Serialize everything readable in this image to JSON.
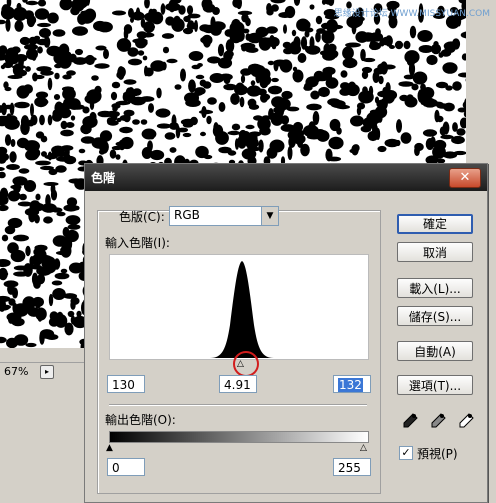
{
  "watermark": "思缘设计论坛 WWW.MISSYUAN.COM",
  "status": {
    "zoom": "67%"
  },
  "dialog": {
    "title": "色階",
    "close_label": "✕",
    "channel_label": "色版(C):",
    "channel_value": "RGB",
    "input_levels_label": "輸入色階(I):",
    "input_black": "130",
    "input_gamma": "4.91",
    "input_white": "132",
    "output_levels_label": "輸出色階(O):",
    "output_black": "0",
    "output_white": "255",
    "buttons": {
      "ok": "確定",
      "cancel": "取消",
      "load": "載入(L)...",
      "save": "儲存(S)...",
      "auto": "自動(A)",
      "options": "選項(T)..."
    },
    "preview_label": "預視(P)",
    "preview_checked": true
  },
  "colors": {
    "highlight": "#3b77d6",
    "annotation_circle": "#d21d1d"
  }
}
